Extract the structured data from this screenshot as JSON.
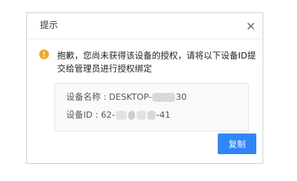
{
  "dialog": {
    "title": "提示",
    "message": "抱歉，您尚未获得该设备的授权，请将以下设备ID提交给管理员进行授权绑定",
    "device_name_label": "设备名称 : DESKTOP-",
    "device_name_suffix": "30",
    "device_id_label": "设备ID   : 62-",
    "device_id_suffix": "-41",
    "copy_button_label": "复制"
  },
  "colors": {
    "accent": "#2f86f6",
    "warning": "#f5a623"
  },
  "icons": {
    "close": "close-icon",
    "info": "info-warning-icon"
  }
}
